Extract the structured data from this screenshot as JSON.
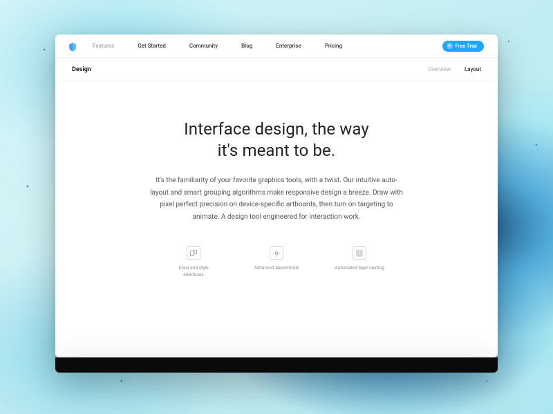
{
  "nav": {
    "items": [
      {
        "label": "Features",
        "active": true
      },
      {
        "label": "Get Started",
        "active": false
      },
      {
        "label": "Community",
        "active": false
      },
      {
        "label": "Blog",
        "active": false
      },
      {
        "label": "Enterprise",
        "active": false
      },
      {
        "label": "Pricing",
        "active": false
      }
    ],
    "cta_label": "Free Trial"
  },
  "subnav": {
    "title": "Design",
    "tabs": [
      {
        "label": "Overview",
        "muted": true
      },
      {
        "label": "Layout",
        "muted": false
      }
    ]
  },
  "hero": {
    "headline_l1": "Interface design, the way",
    "headline_l2": "it's meant to be.",
    "body": "It's the familiarity of your favorite graphics tools, with a twist. Our intuitive auto-layout and smart grouping algorithms make responsive design a breeze. Draw with pixel perfect precision on device-specific artboards, then turn on targeting to animate. A design tool engineered for interaction work."
  },
  "features": [
    {
      "label": "Draw and style interfaces",
      "icon": "artboards-icon"
    },
    {
      "label": "Advanced layout tools",
      "icon": "layout-tools-icon"
    },
    {
      "label": "Automated layer nesting",
      "icon": "layer-nesting-icon"
    }
  ],
  "colors": {
    "accent": "#1ea7ff"
  }
}
